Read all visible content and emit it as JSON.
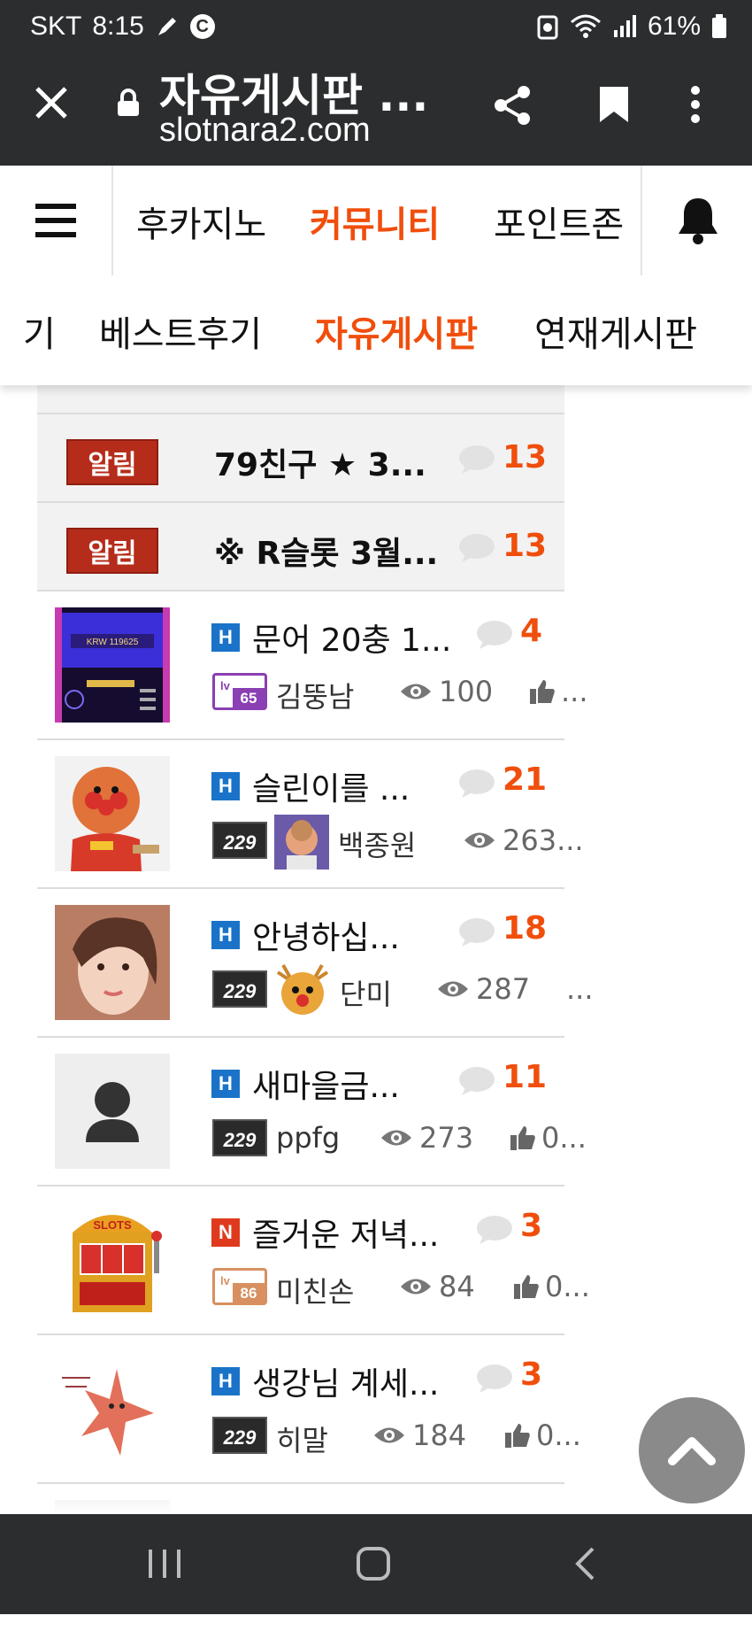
{
  "status_bar": {
    "carrier": "SKT",
    "time": "8:15",
    "battery": "61%"
  },
  "browser": {
    "page_title": "자유게시판 ...",
    "url": "slotnara2.com"
  },
  "main_nav": {
    "tabs": [
      {
        "label": "후카지노"
      },
      {
        "label": "커뮤니티",
        "active": true
      },
      {
        "label": "포인트존"
      }
    ]
  },
  "sub_nav": {
    "tabs": [
      {
        "label": "기"
      },
      {
        "label": "베스트후기"
      },
      {
        "label": "자유게시판",
        "active": true
      },
      {
        "label": "연재게시판"
      }
    ]
  },
  "notices": [
    {
      "badge": "알림",
      "title": "79친구 ★ 3...",
      "comments": "13"
    },
    {
      "badge": "알림",
      "title": "※ R슬롯 3월...",
      "comments": "13"
    }
  ],
  "posts": [
    {
      "type": "H",
      "title": "문어 20충 1...",
      "comments": "4",
      "level": "65",
      "author": "김뚱남",
      "views": "100",
      "likes": "..."
    },
    {
      "type": "H",
      "title": "슬린이를 ...",
      "comments": "21",
      "level": "229",
      "author": "백종원",
      "views": "263...",
      "likes": ""
    },
    {
      "type": "H",
      "title": "안녕하십...",
      "comments": "18",
      "level": "229",
      "author": "단미",
      "views": "287",
      "likes": "..."
    },
    {
      "type": "H",
      "title": "새마을금...",
      "comments": "11",
      "level": "229",
      "author": "ppfg",
      "views": "273",
      "likes": "0..."
    },
    {
      "type": "N",
      "title": "즐거운 저녁...",
      "comments": "3",
      "level": "86",
      "author": "미친손",
      "views": "84",
      "likes": "0..."
    },
    {
      "type": "H",
      "title": "생강님 계세...",
      "comments": "3",
      "level": "229",
      "author": "히말",
      "views": "184",
      "likes": "0..."
    }
  ],
  "thumbnail_texts": {
    "slot_screen": "KRW 119625",
    "slot_machine": "SLOTS"
  },
  "colors": {
    "accent": "#f04e0c",
    "notice_badge": "#b52c1a",
    "h_badge": "#1a73c8",
    "n_badge": "#e03a1e",
    "dark_bar": "#2b2d2f"
  }
}
